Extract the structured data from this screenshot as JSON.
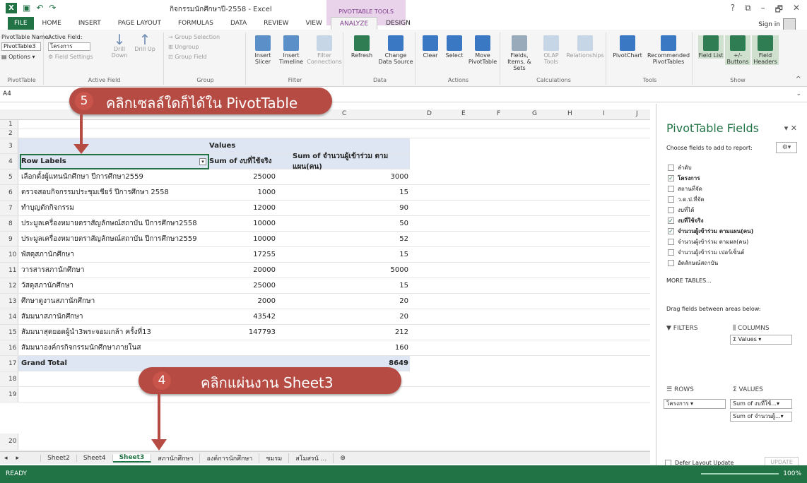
{
  "window": {
    "title": "กิจกรรมนักศึกษาปี-2558 - Excel",
    "contextual_tab": "PIVOTTABLE TOOLS",
    "controls": [
      "?",
      "⧉",
      "–",
      "🗗",
      "✕"
    ],
    "sign_in": "Sign in"
  },
  "tabs": [
    "FILE",
    "HOME",
    "INSERT",
    "PAGE LAYOUT",
    "FORMULAS",
    "DATA",
    "REVIEW",
    "VIEW",
    "ANALYZE",
    "DESIGN"
  ],
  "ribbon": {
    "pivottable_name_label": "PivotTable Name:",
    "pivottable_name_value": "PivotTable3",
    "options_label": "Options",
    "group_pivottable": "PivotTable",
    "active_field_label": "Active Field:",
    "active_field_value": "โครงการ",
    "field_settings": "Field Settings",
    "drill_down": "Drill Down",
    "drill_up": "Drill Up",
    "group_active_field": "Active Field",
    "group_selection": "Group Selection",
    "ungroup": "Ungroup",
    "group_field": "Group Field",
    "group_group": "Group",
    "insert_slicer": "Insert Slicer",
    "insert_timeline": "Insert Timeline",
    "filter_connections": "Filter Connections",
    "group_filter": "Filter",
    "refresh": "Refresh",
    "change_data_source": "Change Data Source",
    "group_data": "Data",
    "clear": "Clear",
    "select": "Select",
    "move_pivottable": "Move PivotTable",
    "group_actions": "Actions",
    "fields_items_sets": "Fields, Items, & Sets",
    "olap_tools": "OLAP Tools",
    "relationships": "Relationships",
    "group_calculations": "Calculations",
    "pivotchart": "PivotChart",
    "recommended_pivottables": "Recommended PivotTables",
    "group_tools": "Tools",
    "field_list": "Field List",
    "buttons": "+/- Buttons",
    "field_headers": "Field Headers",
    "group_show": "Show"
  },
  "formula_bar": {
    "name_box": "A4"
  },
  "callouts": [
    {
      "number": "5",
      "text": "คลิกเซลล์ใดก็ได้ใน PivotTable"
    },
    {
      "number": "4",
      "text": "คลิกแผ่นงาน Sheet3"
    }
  ],
  "grid": {
    "columns": [
      "C",
      "D",
      "E",
      "F",
      "G",
      "H",
      "I",
      "J"
    ],
    "values_header": "Values",
    "headers": [
      "Row Labels",
      "Sum of งบที่ใช้จริง",
      "Sum of จำนวนผู้เข้าร่วม ตามแผน(คน)"
    ],
    "rows": [
      {
        "n": "5",
        "label": "เลือกตั้งผู้แทนนักศึกษา ปีการศึกษา2559",
        "b": "25000",
        "c": "3000"
      },
      {
        "n": "6",
        "label": "ตรวจสอบกิจกรรมประชุมเชียร์ ปีการศึกษา 2558",
        "b": "1000",
        "c": "15"
      },
      {
        "n": "7",
        "label": "ทำบุญตักกิจกรรม",
        "b": "12000",
        "c": "90"
      },
      {
        "n": "8",
        "label": "ประมูลเครื่องหมายตราสัญลักษณ์สถาบัน ปีการศึกษา2558",
        "b": "10000",
        "c": "50"
      },
      {
        "n": "9",
        "label": "ประมูลเครื่องหมายตราสัญลักษณ์สถาบัน ปีการศึกษา2559",
        "b": "10000",
        "c": "52"
      },
      {
        "n": "10",
        "label": "พัสดุสภานักศึกษา",
        "b": "17255",
        "c": "15"
      },
      {
        "n": "11",
        "label": "วารสารสภานักศึกษา",
        "b": "20000",
        "c": "5000"
      },
      {
        "n": "12",
        "label": "วัสดุสภานักศึกษา",
        "b": "25000",
        "c": "15"
      },
      {
        "n": "13",
        "label": "ศึกษาดูงานสภานักศึกษา",
        "b": "2000",
        "c": "20"
      },
      {
        "n": "14",
        "label": "สัมมนาสภานักศึกษา",
        "b": "43542",
        "c": "20"
      },
      {
        "n": "15",
        "label": "สัมมนาสุดยอดผู้นำ3พระจอมเกล้า ครั้งที่13",
        "b": "147793",
        "c": "212"
      },
      {
        "n": "16",
        "label": "สัมมนาองค์กรกิจกรรมนักศึกษาภายในส",
        "b": "",
        "c": "160"
      }
    ],
    "grand_total": {
      "n": "17",
      "label": "Grand Total",
      "b": "",
      "c": "8649"
    },
    "empty_rows": [
      "18",
      "19",
      "20"
    ],
    "row_numbers_top": [
      "1",
      "2",
      "3",
      "4"
    ]
  },
  "sheet_tabs": [
    "Sheet2",
    "Sheet4",
    "Sheet3",
    "สภานักศึกษา",
    "องค์การนักศึกษา",
    "ชมรม",
    "สโมสรนั ..."
  ],
  "active_sheet": "Sheet3",
  "status": {
    "ready": "READY",
    "zoom": "100%"
  },
  "pane": {
    "title": "PivotTable Fields",
    "choose": "Choose fields to add to report:",
    "fields": [
      {
        "name": "ลำดับ",
        "checked": false
      },
      {
        "name": "โครงการ",
        "checked": true
      },
      {
        "name": "สถานที่จัด",
        "checked": false
      },
      {
        "name": "ว.ด.ป.ที่จัด",
        "checked": false
      },
      {
        "name": "งบที่ได้",
        "checked": false
      },
      {
        "name": "งบที่ใช้จริง",
        "checked": true
      },
      {
        "name": "จำนวนผู้เข้าร่วม ตามแผน(คน)",
        "checked": true
      },
      {
        "name": "จำนวนผู้เข้าร่วม ตามผล(คน)",
        "checked": false
      },
      {
        "name": "จำนวนผู้เข้าร่วม เปอร์เซ็นต์",
        "checked": false
      },
      {
        "name": "อัตลักษณ์สถาบัน",
        "checked": false
      }
    ],
    "more_tables": "MORE TABLES...",
    "drag_label": "Drag fields between areas below:",
    "filters": "FILTERS",
    "columns": "COLUMNS",
    "columns_item": "Σ Values",
    "rows": "ROWS",
    "rows_item": "โครงการ",
    "values": "Σ VALUES",
    "values_items": [
      "Sum of งบที่ใช้...",
      "Sum of จำนวนผู้..."
    ],
    "defer": "Defer Layout Update",
    "update": "UPDATE"
  }
}
